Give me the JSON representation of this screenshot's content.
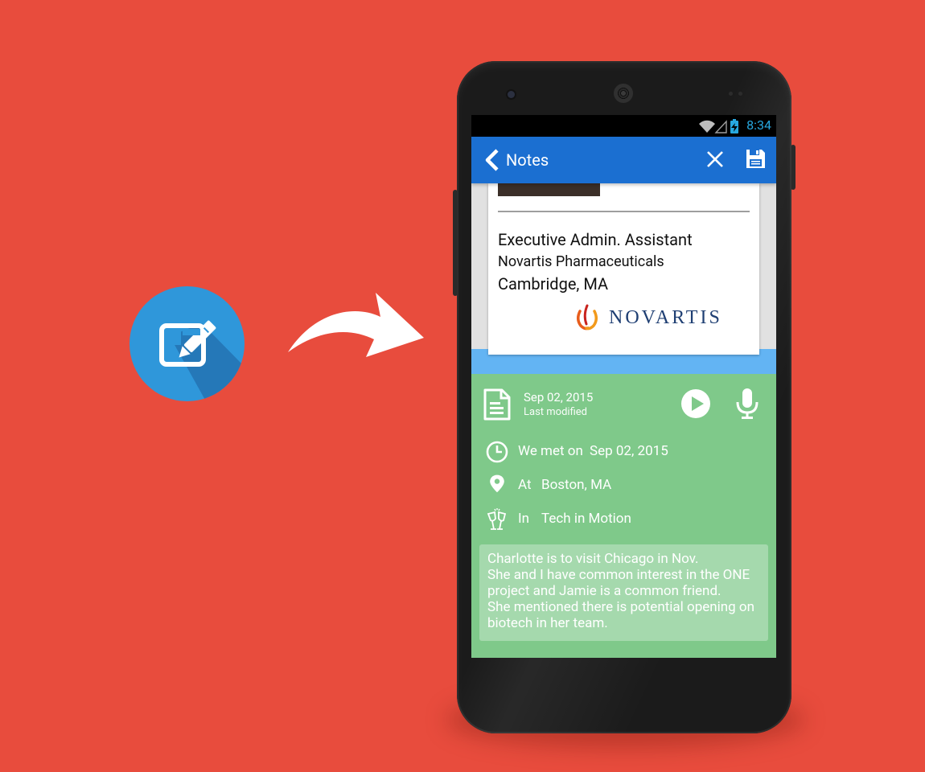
{
  "status_bar": {
    "time": "8:34"
  },
  "app_bar": {
    "title": "Notes"
  },
  "card": {
    "job_title": "Executive Admin. Assistant",
    "company": "Novartis Pharmaceuticals",
    "location": "Cambridge, MA",
    "logo_text": "NOVARTIS"
  },
  "note": {
    "date": "Sep 02, 2015",
    "date_caption": "Last modified",
    "met_label": "We met on",
    "met_value": "Sep 02, 2015",
    "at_label": "At",
    "at_value": "Boston, MA",
    "in_label": "In",
    "in_value": "Tech in Motion",
    "text": "Charlotte is to visit Chicago in Nov.\nShe and I have common interest in the ONE project and Jamie is a common friend.\nShe mentioned there is potential opening on biotech in her team."
  },
  "colors": {
    "background": "#e84c3d",
    "app_bar": "#1b6fd1",
    "notes_panel": "#7fc98a",
    "promo_icon": "#2f97da",
    "status_accent": "#27a8e0"
  },
  "icons": {
    "promo": "edit-note-icon",
    "arrow": "curved-arrow-icon",
    "back": "chevron-left-icon",
    "close": "close-icon",
    "save": "floppy-save-icon",
    "document": "document-icon",
    "play": "play-icon",
    "mic": "microphone-icon",
    "clock": "clock-icon",
    "location": "location-pin-icon",
    "event": "cheers-glasses-icon"
  }
}
